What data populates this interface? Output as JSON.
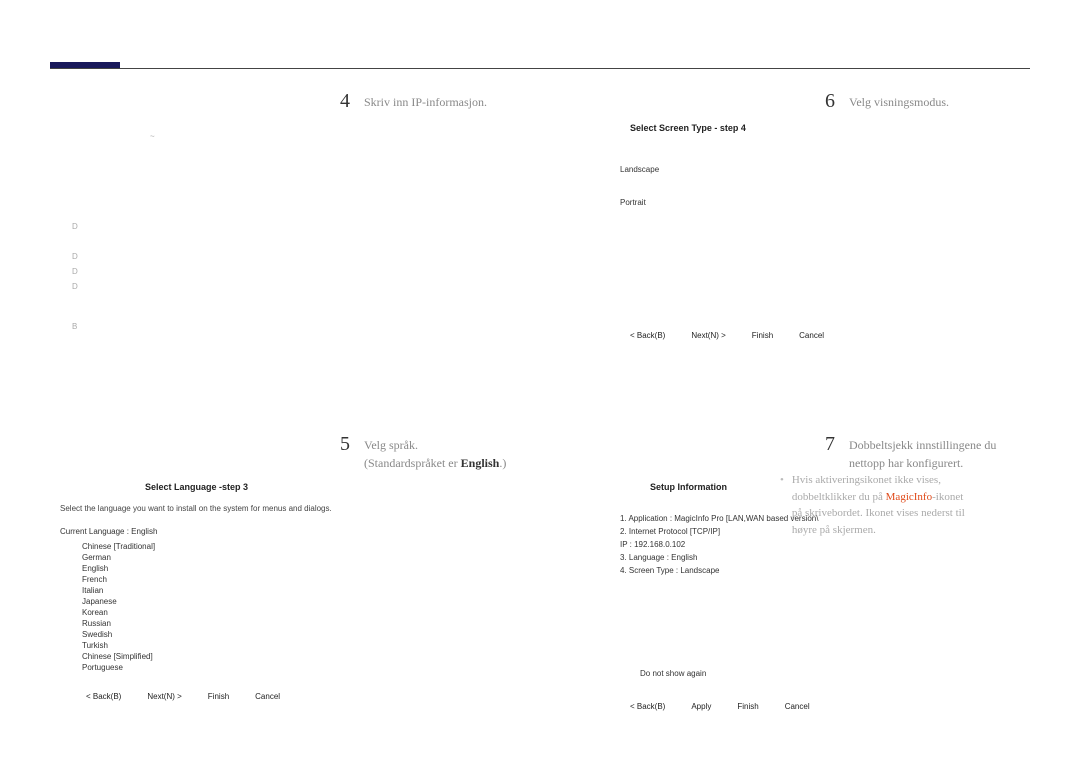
{
  "steps": {
    "s4": {
      "num": "4",
      "text": "Skriv inn IP-informasjon."
    },
    "s5": {
      "num": "5",
      "text": "Velg språk.",
      "sub_prefix": "(Standardspråket er ",
      "sub_bold": "English",
      "sub_suffix": ".)"
    },
    "s6": {
      "num": "6",
      "text": "Velg visningsmodus."
    },
    "s7": {
      "num": "7",
      "text1": "Dobbeltsjekk innstillingene du",
      "text2": "nettopp har konfigurert."
    }
  },
  "step4_marks": {
    "tilde": "~",
    "d": "D",
    "b": "B"
  },
  "step5_panel": {
    "title": "Select Language -step 3",
    "sub": "Select the language you want to install on the system for menus and dialogs.",
    "current_label": "Current Language    :    English",
    "languages": [
      "Chinese [Traditional]",
      "German",
      "English",
      "French",
      "Italian",
      "Japanese",
      "Korean",
      "Russian",
      "Swedish",
      "Turkish",
      "Chinese [Simplified]",
      "Portuguese"
    ],
    "buttons": {
      "back": "< Back(B)",
      "next": "Next(N) >",
      "finish": "Finish",
      "cancel": "Cancel"
    }
  },
  "step6_panel": {
    "title": "Select Screen Type - step 4",
    "opt1": "Landscape",
    "opt2": "Portrait",
    "buttons": {
      "back": "< Back(B)",
      "next": "Next(N) >",
      "finish": "Finish",
      "cancel": "Cancel"
    }
  },
  "step7_panel": {
    "title": "Setup Information",
    "lines": [
      "1. Application  :      MagicInfo Pro [LAN,WAN based version\\",
      "2. Internet Protocol [TCP/IP]",
      "    IP  :      192.168.0.102",
      "3. Language  :      English",
      "4. Screen Type  :     Landscape"
    ],
    "dont_show": "Do not show again",
    "buttons": {
      "back": "< Back(B)",
      "apply": "Apply",
      "finish": "Finish",
      "cancel": "Cancel"
    }
  },
  "note": {
    "bullet": "•",
    "line1_a": "Hvis aktiveringsikonet ikke vises,",
    "line2_a": "dobbeltklikker du på ",
    "brand": "MagicInfo",
    "line2_b": "-ikonet",
    "line3": "på skrivebordet. Ikonet vises nederst til",
    "line4": "høyre på skjermen."
  }
}
